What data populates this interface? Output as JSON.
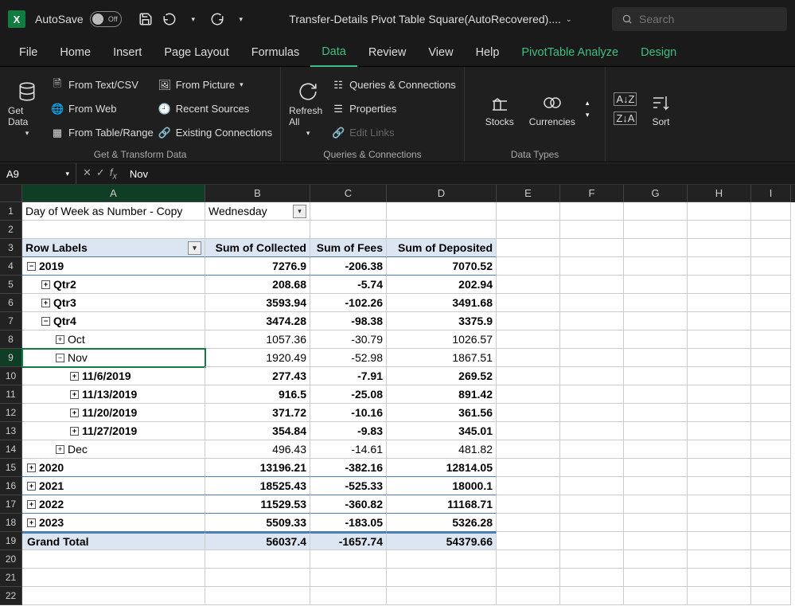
{
  "title_bar": {
    "autosave_label": "AutoSave",
    "autosave_state": "Off",
    "doc_title": "Transfer-Details Pivot Table Square(AutoRecovered)....",
    "search_placeholder": "Search"
  },
  "tabs": {
    "items": [
      "File",
      "Home",
      "Insert",
      "Page Layout",
      "Formulas",
      "Data",
      "Review",
      "View",
      "Help"
    ],
    "active": "Data",
    "context": [
      "PivotTable Analyze",
      "Design"
    ]
  },
  "ribbon": {
    "get_data": {
      "big": "Get Data",
      "items": [
        "From Text/CSV",
        "From Web",
        "From Table/Range",
        "From Picture",
        "Recent Sources",
        "Existing Connections"
      ],
      "group": "Get & Transform Data"
    },
    "queries": {
      "big": "Refresh All",
      "items": [
        "Queries & Connections",
        "Properties",
        "Edit Links"
      ],
      "group": "Queries & Connections"
    },
    "data_types": {
      "items": [
        "Stocks",
        "Currencies"
      ],
      "group": "Data Types"
    },
    "sort_filter": {
      "sort": "Sort"
    }
  },
  "namebox": "A9",
  "formula": "Nov",
  "columns": [
    "A",
    "B",
    "C",
    "D",
    "E",
    "F",
    "G",
    "H",
    "I"
  ],
  "pivot": {
    "filter_label": "Day of Week as Number - Copy",
    "filter_value": "Wednesday",
    "headers": [
      "Row Labels",
      "Sum of Collected",
      "Sum of Fees",
      "Sum of Deposited"
    ],
    "rows": [
      {
        "n": 4,
        "indent": 0,
        "exp": "minus",
        "label": "2019",
        "b": "7276.9",
        "c": "-206.38",
        "d": "7070.52",
        "bold": true,
        "line": true
      },
      {
        "n": 5,
        "indent": 1,
        "exp": "plus",
        "label": "Qtr2",
        "b": "208.68",
        "c": "-5.74",
        "d": "202.94",
        "bold": true
      },
      {
        "n": 6,
        "indent": 1,
        "exp": "plus",
        "label": "Qtr3",
        "b": "3593.94",
        "c": "-102.26",
        "d": "3491.68",
        "bold": true
      },
      {
        "n": 7,
        "indent": 1,
        "exp": "minus",
        "label": "Qtr4",
        "b": "3474.28",
        "c": "-98.38",
        "d": "3375.9",
        "bold": true
      },
      {
        "n": 8,
        "indent": 2,
        "exp": "plus",
        "label": "Oct",
        "b": "1057.36",
        "c": "-30.79",
        "d": "1026.57"
      },
      {
        "n": 9,
        "indent": 2,
        "exp": "minus",
        "label": "Nov",
        "b": "1920.49",
        "c": "-52.98",
        "d": "1867.51",
        "selected": true
      },
      {
        "n": 10,
        "indent": 3,
        "exp": "plus",
        "label": "11/6/2019",
        "b": "277.43",
        "c": "-7.91",
        "d": "269.52",
        "bold": true
      },
      {
        "n": 11,
        "indent": 3,
        "exp": "plus",
        "label": "11/13/2019",
        "b": "916.5",
        "c": "-25.08",
        "d": "891.42",
        "bold": true
      },
      {
        "n": 12,
        "indent": 3,
        "exp": "plus",
        "label": "11/20/2019",
        "b": "371.72",
        "c": "-10.16",
        "d": "361.56",
        "bold": true
      },
      {
        "n": 13,
        "indent": 3,
        "exp": "plus",
        "label": "11/27/2019",
        "b": "354.84",
        "c": "-9.83",
        "d": "345.01",
        "bold": true
      },
      {
        "n": 14,
        "indent": 2,
        "exp": "plus",
        "label": "Dec",
        "b": "496.43",
        "c": "-14.61",
        "d": "481.82"
      },
      {
        "n": 15,
        "indent": 0,
        "exp": "plus",
        "label": "2020",
        "b": "13196.21",
        "c": "-382.16",
        "d": "12814.05",
        "bold": true,
        "line": true
      },
      {
        "n": 16,
        "indent": 0,
        "exp": "plus",
        "label": "2021",
        "b": "18525.43",
        "c": "-525.33",
        "d": "18000.1",
        "bold": true,
        "line": true
      },
      {
        "n": 17,
        "indent": 0,
        "exp": "plus",
        "label": "2022",
        "b": "11529.53",
        "c": "-360.82",
        "d": "11168.71",
        "bold": true,
        "line": true
      },
      {
        "n": 18,
        "indent": 0,
        "exp": "plus",
        "label": "2023",
        "b": "5509.33",
        "c": "-183.05",
        "d": "5326.28",
        "bold": true,
        "line": true
      },
      {
        "n": 19,
        "indent": 0,
        "label": "Grand Total",
        "b": "56037.4",
        "c": "-1657.74",
        "d": "54379.66",
        "bold": true,
        "total": true
      }
    ]
  }
}
